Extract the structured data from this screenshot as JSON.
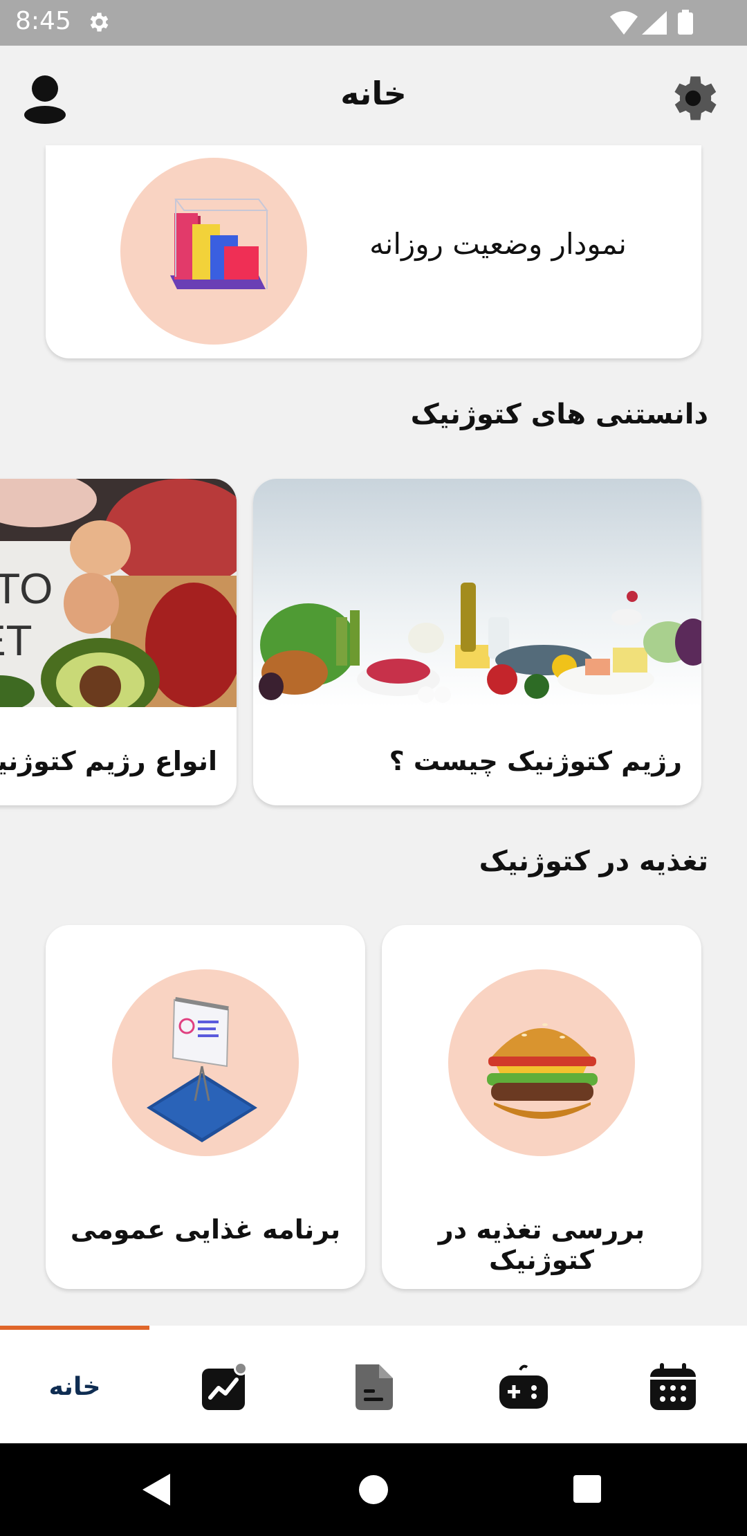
{
  "status_bar": {
    "time": "8:45"
  },
  "header": {
    "title": "خانه"
  },
  "daily_chart": {
    "label": "نمودار وضعیت روزانه",
    "icon": "bar-chart-3d-icon"
  },
  "keto_knowledge": {
    "title": "دانستنی های کتوژنیک",
    "articles": [
      {
        "caption": "رژیم کتوژنیک چیست ؟",
        "image": "keto-foods-spread-photo"
      },
      {
        "caption": "انواع رژیم کتوژنیک",
        "image": "keto-diet-board-photo",
        "image_text": "KETO DIET"
      }
    ]
  },
  "nutrition": {
    "title": "تغذیه در کتوژنیک",
    "cards": [
      {
        "caption": "بررسی تغذیه در کتوژنیک",
        "icon": "burger-icon"
      },
      {
        "caption": "برنامه غذایی عمومی",
        "icon": "presentation-board-icon"
      }
    ]
  },
  "bottom_nav": {
    "items": [
      {
        "label": "خانه",
        "icon": "home-tab"
      },
      {
        "icon": "trend-chart-icon"
      },
      {
        "icon": "document-icon"
      },
      {
        "icon": "gamepad-icon"
      },
      {
        "icon": "calendar-icon"
      }
    ],
    "active_index": 0
  },
  "colors": {
    "accent": "#e0662a",
    "circle_bg": "#f9d3c2",
    "nav_label": "#0f2d52",
    "background": "#f1f1f1"
  }
}
